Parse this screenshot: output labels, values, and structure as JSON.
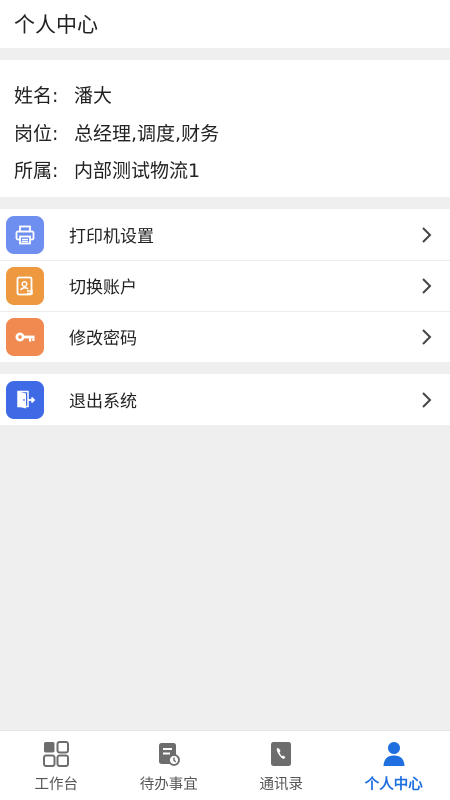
{
  "header": {
    "title": "个人中心"
  },
  "profile": {
    "name_label": "姓名:",
    "name_value": "潘大",
    "role_label": "岗位:",
    "role_value": "总经理,调度,财务",
    "org_label": "所属:",
    "org_value": "内部测试物流1"
  },
  "menu": {
    "items": [
      {
        "label": "打印机设置",
        "icon": "printer-icon",
        "color": "#6f8ff0"
      },
      {
        "label": "切换账户",
        "icon": "switch-account-icon",
        "color": "#ee9940"
      },
      {
        "label": "修改密码",
        "icon": "key-icon",
        "color": "#f08a50"
      }
    ],
    "logout": {
      "label": "退出系统",
      "icon": "logout-door-icon",
      "color": "#3f6ae6"
    }
  },
  "tabbar": {
    "tabs": [
      {
        "label": "工作台",
        "icon": "grid-icon",
        "active": false
      },
      {
        "label": "待办事宜",
        "icon": "todo-list-icon",
        "active": false
      },
      {
        "label": "通讯录",
        "icon": "contacts-phone-icon",
        "active": false
      },
      {
        "label": "个人中心",
        "icon": "person-icon",
        "active": true
      }
    ],
    "active_color": "#1f6fe0",
    "inactive_color": "#666666"
  }
}
